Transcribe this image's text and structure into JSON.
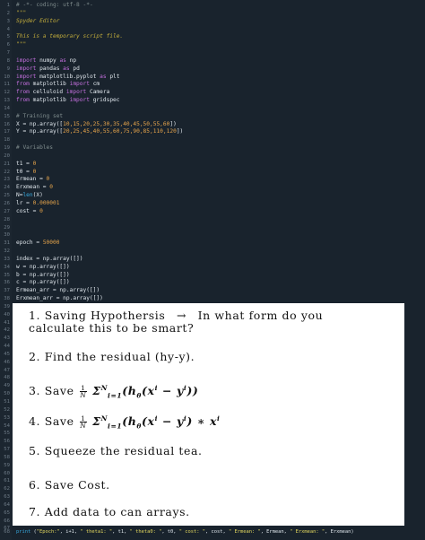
{
  "editor": {
    "lines": [
      {
        "n": "1",
        "t": [
          [
            "t-comment",
            "# -*- coding: utf-8 -*-"
          ]
        ]
      },
      {
        "n": "2",
        "t": [
          [
            "t-doc",
            "\"\"\""
          ]
        ]
      },
      {
        "n": "3",
        "t": [
          [
            "t-doc",
            "Spyder Editor"
          ]
        ]
      },
      {
        "n": "4",
        "t": []
      },
      {
        "n": "5",
        "t": [
          [
            "t-doc",
            "This is a temporary script file."
          ]
        ]
      },
      {
        "n": "6",
        "t": [
          [
            "t-doc",
            "\"\"\""
          ]
        ]
      },
      {
        "n": "7",
        "t": []
      },
      {
        "n": "8",
        "t": [
          [
            "t-kw",
            "import"
          ],
          [
            "t-name",
            " numpy "
          ],
          [
            "t-kw",
            "as"
          ],
          [
            "t-name",
            " np"
          ]
        ]
      },
      {
        "n": "9",
        "t": [
          [
            "t-kw",
            "import"
          ],
          [
            "t-name",
            " pandas "
          ],
          [
            "t-kw",
            "as"
          ],
          [
            "t-name",
            " pd"
          ]
        ]
      },
      {
        "n": "10",
        "t": [
          [
            "t-kw",
            "import"
          ],
          [
            "t-name",
            " matplotlib.pyplot "
          ],
          [
            "t-kw",
            "as"
          ],
          [
            "t-name",
            " plt"
          ]
        ]
      },
      {
        "n": "11",
        "t": [
          [
            "t-kw",
            "from"
          ],
          [
            "t-name",
            " matplotlib "
          ],
          [
            "t-kw",
            "import"
          ],
          [
            "t-name",
            " cm"
          ]
        ]
      },
      {
        "n": "12",
        "t": [
          [
            "t-kw",
            "from"
          ],
          [
            "t-name",
            " celluloid "
          ],
          [
            "t-kw",
            "import"
          ],
          [
            "t-name",
            " Camera"
          ]
        ]
      },
      {
        "n": "13",
        "t": [
          [
            "t-kw",
            "from"
          ],
          [
            "t-name",
            " matplotlib "
          ],
          [
            "t-kw",
            "import"
          ],
          [
            "t-name",
            " gridspec"
          ]
        ]
      },
      {
        "n": "14",
        "t": []
      },
      {
        "n": "15",
        "t": [
          [
            "t-comment",
            "# Training set"
          ]
        ]
      },
      {
        "n": "16",
        "t": [
          [
            "t-name",
            "X = np.array(["
          ],
          [
            "t-num",
            "10,15,20,25,30,35,40,45,50,55,60"
          ],
          [
            "t-name",
            "])"
          ]
        ]
      },
      {
        "n": "17",
        "t": [
          [
            "t-name",
            "Y = np.array(["
          ],
          [
            "t-num",
            "20,25,45,40,55,60,75,90,85,110,120"
          ],
          [
            "t-name",
            "])"
          ]
        ]
      },
      {
        "n": "18",
        "t": []
      },
      {
        "n": "19",
        "t": [
          [
            "t-comment",
            "# Variables"
          ]
        ]
      },
      {
        "n": "20",
        "t": []
      },
      {
        "n": "21",
        "t": [
          [
            "t-name",
            "t1 = "
          ],
          [
            "t-num",
            "0"
          ]
        ]
      },
      {
        "n": "22",
        "t": [
          [
            "t-name",
            "t0 = "
          ],
          [
            "t-num",
            "0"
          ]
        ]
      },
      {
        "n": "23",
        "t": [
          [
            "t-name",
            "Ermean = "
          ],
          [
            "t-num",
            "0"
          ]
        ]
      },
      {
        "n": "24",
        "t": [
          [
            "t-name",
            "Erxmean = "
          ],
          [
            "t-num",
            "0"
          ]
        ]
      },
      {
        "n": "25",
        "t": [
          [
            "t-name",
            "N="
          ],
          [
            "t-builtin",
            "len"
          ],
          [
            "t-name",
            "(X)"
          ]
        ]
      },
      {
        "n": "26",
        "t": [
          [
            "t-name",
            "lr = "
          ],
          [
            "t-num",
            "0.000001"
          ]
        ]
      },
      {
        "n": "27",
        "t": [
          [
            "t-name",
            "cost = "
          ],
          [
            "t-num",
            "0"
          ]
        ]
      },
      {
        "n": "28",
        "t": []
      },
      {
        "n": "29",
        "t": []
      },
      {
        "n": "30",
        "t": []
      },
      {
        "n": "31",
        "t": [
          [
            "t-name",
            "epoch = "
          ],
          [
            "t-num",
            "50000"
          ]
        ]
      },
      {
        "n": "32",
        "t": []
      },
      {
        "n": "33",
        "t": [
          [
            "t-name",
            "index = np.array([])"
          ]
        ]
      },
      {
        "n": "34",
        "t": [
          [
            "t-name",
            "w = np.array([])"
          ]
        ]
      },
      {
        "n": "35",
        "t": [
          [
            "t-name",
            "b = np.array([])"
          ]
        ]
      },
      {
        "n": "36",
        "t": [
          [
            "t-name",
            "c = np.array([])"
          ]
        ]
      },
      {
        "n": "37",
        "t": [
          [
            "t-name",
            "Ermean_arr = np.array([])"
          ]
        ]
      },
      {
        "n": "38",
        "t": [
          [
            "t-name",
            "Erxmean_arr = np.array([])"
          ]
        ]
      },
      {
        "n": "39",
        "t": []
      },
      {
        "n": "40",
        "t": []
      },
      {
        "n": "41",
        "t": []
      },
      {
        "n": "42",
        "t": []
      },
      {
        "n": "43",
        "t": []
      },
      {
        "n": "44",
        "t": []
      },
      {
        "n": "45",
        "t": []
      },
      {
        "n": "46",
        "t": []
      },
      {
        "n": "47",
        "t": []
      },
      {
        "n": "48",
        "t": []
      },
      {
        "n": "49",
        "t": []
      },
      {
        "n": "50",
        "t": []
      },
      {
        "n": "51",
        "t": []
      },
      {
        "n": "52",
        "t": []
      },
      {
        "n": "53",
        "t": []
      },
      {
        "n": "54",
        "t": []
      },
      {
        "n": "55",
        "t": []
      },
      {
        "n": "56",
        "t": []
      },
      {
        "n": "57",
        "t": []
      },
      {
        "n": "58",
        "t": []
      },
      {
        "n": "59",
        "t": []
      },
      {
        "n": "60",
        "t": []
      },
      {
        "n": "61",
        "t": []
      },
      {
        "n": "62",
        "t": []
      },
      {
        "n": "63",
        "t": []
      },
      {
        "n": "64",
        "t": []
      },
      {
        "n": "65",
        "t": []
      },
      {
        "n": "66",
        "t": []
      },
      {
        "n": "67",
        "t": []
      }
    ],
    "print_line": {
      "n": "68",
      "t": [
        [
          "t-builtin",
          "print"
        ],
        [
          "t-name",
          " ("
        ],
        [
          "t-str",
          "\"Epoch:\""
        ],
        [
          "t-name",
          ", i+1, "
        ],
        [
          "t-str",
          "\" theta1: \""
        ],
        [
          "t-name",
          ", t1, "
        ],
        [
          "t-str",
          "\" theta0: \""
        ],
        [
          "t-name",
          ", t0, "
        ],
        [
          "t-str",
          "\" cost: \""
        ],
        [
          "t-name",
          ", cost, "
        ],
        [
          "t-str",
          "\" Ermean: \""
        ],
        [
          "t-name",
          ", Ermean, "
        ],
        [
          "t-str",
          "\" Erxmean: \""
        ],
        [
          "t-name",
          ", Erxmean)"
        ]
      ]
    }
  },
  "overlay": {
    "item1_num": "1.",
    "item1_a": "Saving Hypothersis",
    "item1_arrow": "→",
    "item1_b": "In what form do you",
    "item1_c": "calculate this to be smart?",
    "item2": "2.  Find the residual (hy-y).",
    "item3_prefix": "3.  Save",
    "item3_math": "Σ",
    "item3_tail": "(h",
    "item4_prefix": "4.  Save",
    "item5": "5.  Squeeze the residual tea.",
    "item6": "6.  Save Cost.",
    "item7": "7.  Add data to can arrays.",
    "frac_top": "1",
    "frac_bot": "N",
    "sum_sub": "i=1",
    "sum_sup": "N",
    "h_sub": "θ",
    "x_sup": "i",
    "y_sup": "i",
    "item3_expr": "Σ",
    "item4_times": "∗ x"
  }
}
